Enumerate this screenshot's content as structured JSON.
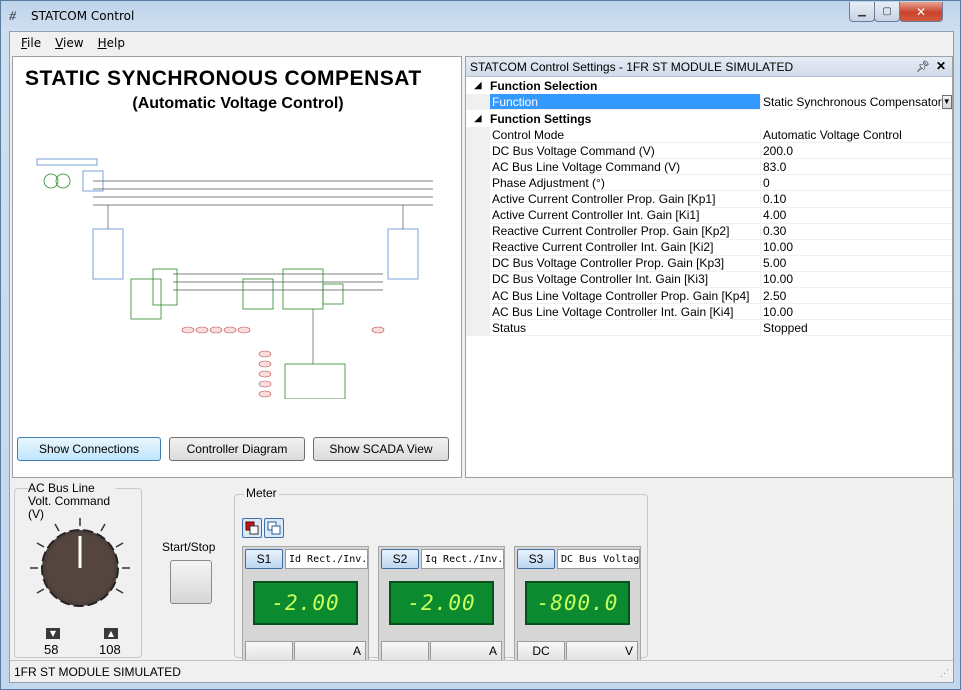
{
  "window": {
    "title": "STATCOM Control",
    "icon": "statcom-app-icon"
  },
  "menu": [
    {
      "label": "File",
      "key": "F"
    },
    {
      "label": "View",
      "key": "V"
    },
    {
      "label": "Help",
      "key": "H"
    }
  ],
  "left": {
    "title": "STATIC  SYNCHRONOUS COMPENSAT",
    "subtitle": "(Automatic Voltage Control)",
    "buttons": {
      "connections": "Show Connections",
      "controller": "Controller Diagram",
      "scada": "Show SCADA View"
    }
  },
  "settings": {
    "header": "STATCOM Control Settings - 1FR ST MODULE SIMULATED",
    "pin_icon": "pin-icon",
    "cat1": "Function Selection",
    "function_name": "Function",
    "function_value": "Static Synchronous Compensator",
    "cat2": "Function Settings",
    "rows": [
      {
        "name": "Control Mode",
        "value": "Automatic Voltage Control"
      },
      {
        "name": "DC Bus Voltage Command (V)",
        "value": "200.0"
      },
      {
        "name": "AC Bus Line Voltage Command (V)",
        "value": "83.0"
      },
      {
        "name": "Phase Adjustment (°)",
        "value": "0"
      },
      {
        "name": "Active Current Controller Prop. Gain [Kp1]",
        "value": "0.10"
      },
      {
        "name": "Active Current Controller Int. Gain [Ki1]",
        "value": "4.00"
      },
      {
        "name": "Reactive Current Controller Prop. Gain [Kp2]",
        "value": "0.30"
      },
      {
        "name": "Reactive Current Controller Int. Gain [Ki2]",
        "value": "10.00"
      },
      {
        "name": "DC Bus Voltage Controller Prop. Gain [Kp3]",
        "value": "5.00"
      },
      {
        "name": "DC Bus Voltage Controller Int. Gain [Ki3]",
        "value": "10.00"
      },
      {
        "name": "AC Bus Line Voltage Controller Prop. Gain [Kp4]",
        "value": "2.50"
      },
      {
        "name": "AC Bus Line Voltage Controller Int. Gain [Ki4]",
        "value": "10.00"
      },
      {
        "name": "Status",
        "value": "Stopped"
      }
    ]
  },
  "knob": {
    "label": "AC Bus Line Volt. Command (V)",
    "min": "58",
    "max": "108"
  },
  "start": {
    "label": "Start/Stop"
  },
  "meter": {
    "label": "Meter",
    "meters": [
      {
        "tag": "S1",
        "name": "Id Rect./Inv.",
        "value": "-2.00",
        "left": "",
        "unit": "A"
      },
      {
        "tag": "S2",
        "name": "Iq Rect./Inv.",
        "value": "-2.00",
        "left": "",
        "unit": "A"
      },
      {
        "tag": "S3",
        "name": "DC Bus Voltage",
        "value": "-800.0",
        "left": "DC",
        "unit": "V"
      }
    ]
  },
  "status": "1FR ST MODULE SIMULATED",
  "colors": {
    "selection": "#3399ff",
    "display_bg": "#0b8a2f",
    "display_fg": "#c8ff5a"
  }
}
